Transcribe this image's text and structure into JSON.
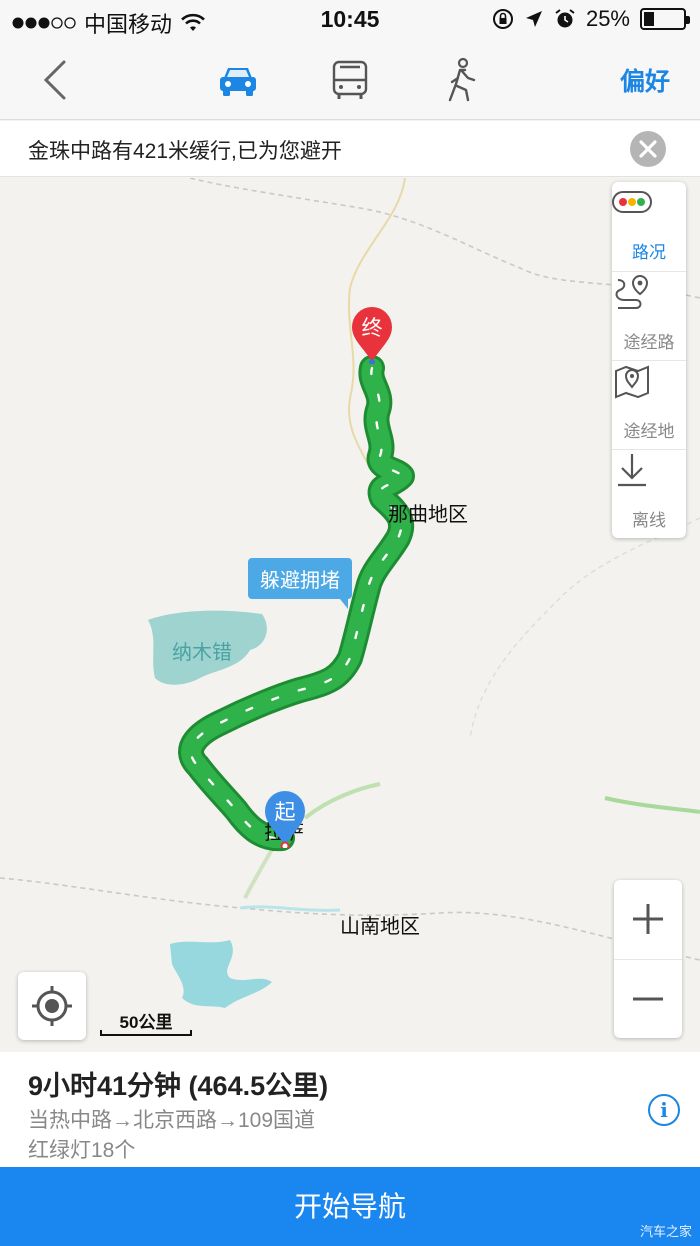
{
  "status_bar": {
    "carrier": "中国移动",
    "time": "10:45",
    "battery": "25%",
    "battery_level": 0.25
  },
  "nav": {
    "back_icon": "chevron-left-icon",
    "modes": [
      "car-icon",
      "bus-icon",
      "walk-icon"
    ],
    "active_mode": "car",
    "preference_label": "偏好"
  },
  "notice": {
    "text": "金珠中路有421米缓行,已为您避开",
    "close_icon": "close-icon"
  },
  "map": {
    "labels": {
      "naqu": "那曲地区",
      "shannan": "山南地区",
      "lhasa": "拉萨",
      "lake": "纳木错"
    },
    "callout": "躲避拥堵",
    "start_pin": "起",
    "end_pin": "终",
    "route_color": "#2fb24a",
    "tools": [
      {
        "icon": "traffic-light-icon",
        "label": "路况"
      },
      {
        "icon": "waypoint-route-icon",
        "label": "途经路"
      },
      {
        "icon": "waypoint-place-icon",
        "label": "途经地"
      },
      {
        "icon": "download-icon",
        "label": "离线"
      }
    ],
    "scale": "50公里"
  },
  "summary": {
    "time_distance": "9小时41分钟 (464.5公里)",
    "route": "当热中路→北京西路→109国道",
    "traffic_lights": "红绿灯18个"
  },
  "start_button": "开始导航",
  "watermark": "汽车之家",
  "colors": {
    "accent": "#1b86e3",
    "button": "#1a86f0",
    "route": "#2fb24a",
    "end_pin": "#e8323c",
    "start_pin": "#3d8fe6"
  }
}
